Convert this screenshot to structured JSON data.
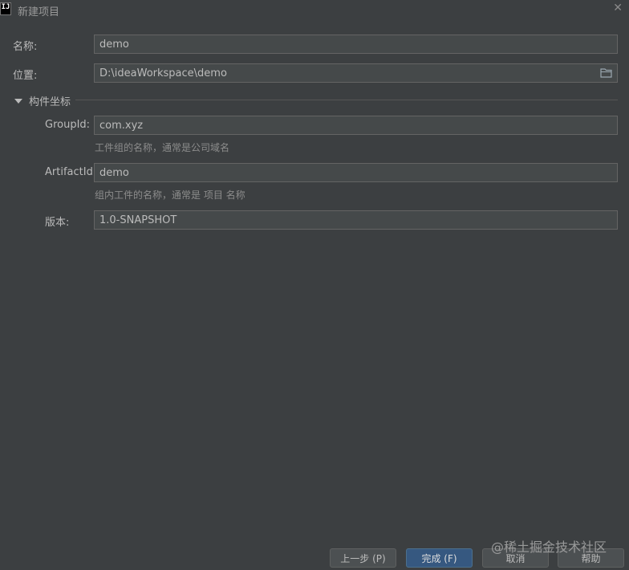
{
  "window": {
    "title": "新建项目",
    "app_icon_text": "IJ"
  },
  "form": {
    "name": {
      "label": "名称:",
      "value": "demo"
    },
    "location": {
      "label": "位置:",
      "value": "D:\\ideaWorkspace\\demo"
    },
    "section_title": "构件坐标",
    "group_id": {
      "label": "GroupId:",
      "value": "com.xyz",
      "hint": "工件组的名称，通常是公司域名"
    },
    "artifact_id": {
      "label": "ArtifactId:",
      "value": "demo",
      "hint": "组内工件的名称，通常是 项目 名称"
    },
    "version": {
      "label": "版本:",
      "value": "1.0-SNAPSHOT"
    }
  },
  "buttons": {
    "previous": "上一步 (P)",
    "finish": "完成 (F)",
    "cancel": "取消",
    "help": "帮助"
  },
  "watermark": "@稀土掘金技术社区",
  "icons": [
    "app-icon",
    "close-icon",
    "folder-icon",
    "collapse-triangle-icon"
  ],
  "colors": {
    "background": "#3c3f41",
    "field_bg": "#45494a",
    "primary_button": "#365880"
  }
}
